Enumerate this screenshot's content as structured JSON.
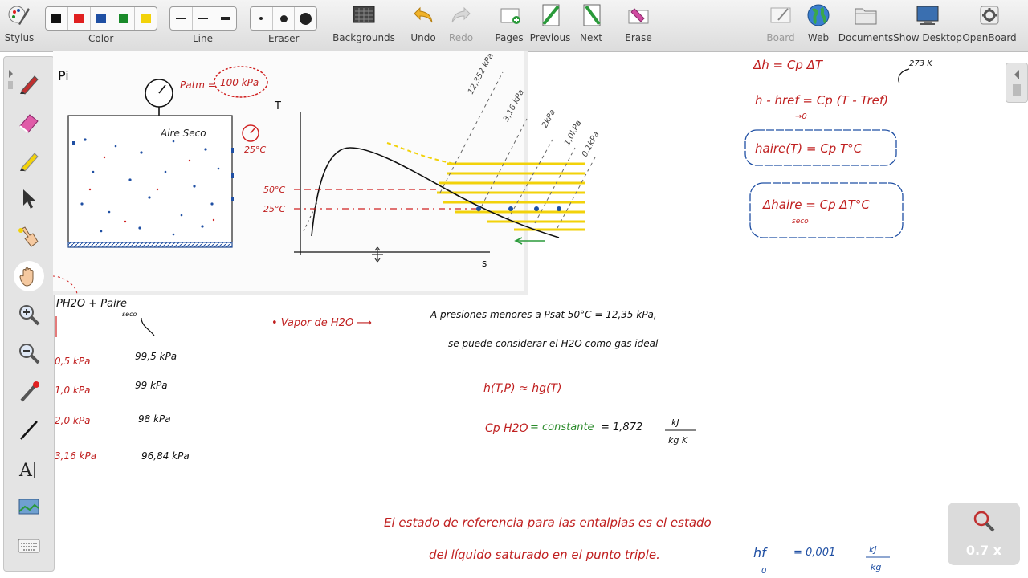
{
  "toolbar": {
    "stylus": "Stylus",
    "color": "Color",
    "line": "Line",
    "eraser": "Eraser",
    "backgrounds": "Backgrounds",
    "undo": "Undo",
    "redo": "Redo",
    "pages": "Pages",
    "previous": "Previous",
    "next": "Next",
    "erase": "Erase",
    "board": "Board",
    "web": "Web",
    "documents": "Documents",
    "show_desktop": "Show Desktop",
    "openboard": "OpenBoard",
    "colors": [
      "#111111",
      "#e02020",
      "#1f4fa3",
      "#1a8a2a",
      "#f2d20a"
    ]
  },
  "zoom": {
    "level": "0.7 x"
  },
  "board": {
    "header_left": "Pi",
    "gauge_label": "Patm =",
    "gauge_value": "100 kPa",
    "tank_label": "Aire Seco",
    "tank_temp": "25°C",
    "axis_t": "T",
    "axis_s": "s",
    "t50": "50°C",
    "t25": "25°C",
    "isobars": [
      "12,352 kPa",
      "3,16 kPa",
      "2kPa",
      "1,0kPa",
      "0,1kPa"
    ],
    "sum_left": "PH2O + Paire",
    "sum_sub": "seco",
    "pv_values": [
      "0,5 kPa",
      "1,0 kPa",
      "2,0 kPa",
      "3,16 kPa"
    ],
    "pa_values": [
      "99,5 kPa",
      "99 kPa",
      "98 kPa",
      "96,84 kPa"
    ],
    "vapor_label": "• Vapor de H2O  ⟶",
    "vapor_text1": "A presiones menores a Psat 50°C = 12,35 kPa,",
    "vapor_text2": "se puede considerar el H2O como gas ideal",
    "h_eq": "h(T,P) ≈ hg(T)",
    "cp_eq_left": "Cp H2O",
    "cp_eq_mid": "= constante",
    "cp_eq_right": "= 1,872",
    "cp_units_top": "kJ",
    "cp_units_bottom": "kg K",
    "ref_text1": "El estado de referencia para las entalpias es el estado",
    "ref_text2": "del líquido saturado en el punto triple.",
    "hf_eq": "hf",
    "hf_value": "= 0,001",
    "hf_units_top": "kJ",
    "hf_units_bottom": "kg",
    "sub_zero": "0",
    "right_eq1": "Δh = Cp ΔT",
    "right_273": "273 K",
    "right_eq2": "h - href = Cp (T - Tref)",
    "right_eq2_sub": "→0",
    "right_eq3": "haire(T) = Cp T°C",
    "right_eq4": "Δhaire = Cp ΔT°C",
    "right_eq4_sub": "seco"
  }
}
